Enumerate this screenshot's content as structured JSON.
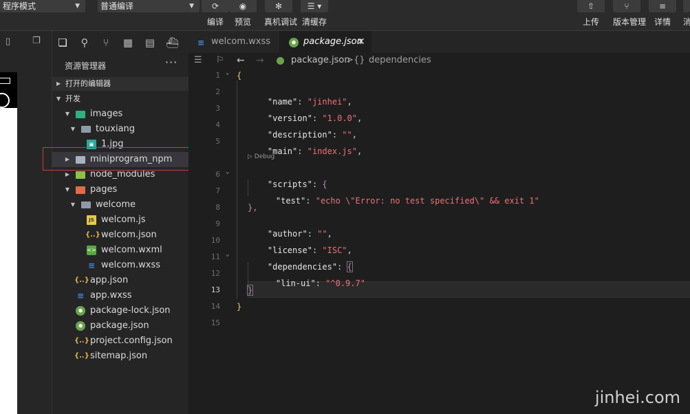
{
  "toolbar": {
    "mode_select": "程序模式",
    "compile_select": "普通编译",
    "compile_label": "编译",
    "preview_label": "预览",
    "debug_label": "真机调试",
    "clear_cache_label": "清缓存",
    "upload_label": "上传",
    "version_label": "版本管理",
    "detail_label": "详情",
    "msg_label": "消"
  },
  "explorer": {
    "title": "资源管理器",
    "more": "···",
    "section_open": "打开的编辑器",
    "section_dev": "开发",
    "tree": [
      {
        "name": "images"
      },
      {
        "name": "touxiang"
      },
      {
        "name": "1.jpg"
      },
      {
        "name": "miniprogram_npm"
      },
      {
        "name": "node_modules"
      },
      {
        "name": "pages"
      },
      {
        "name": "welcome"
      },
      {
        "name": "welcom.js"
      },
      {
        "name": "welcom.json"
      },
      {
        "name": "welcom.wxml"
      },
      {
        "name": "welcom.wxss"
      },
      {
        "name": "app.json"
      },
      {
        "name": "app.wxss"
      },
      {
        "name": "package-lock.json"
      },
      {
        "name": "package.json"
      },
      {
        "name": "project.config.json"
      },
      {
        "name": "sitemap.json"
      }
    ]
  },
  "tabs": [
    {
      "label": "welcom.wxss"
    },
    {
      "label": "package.json"
    }
  ],
  "breadcrumb": {
    "file": "package.json",
    "sep": ">",
    "braces": "{}",
    "node": "dependencies"
  },
  "editor": {
    "codelens": "▷ Debug",
    "line_numbers": [
      "1",
      "2",
      "3",
      "4",
      "5",
      "6",
      "7",
      "8",
      "9",
      "10",
      "11",
      "12",
      "13",
      "14",
      "15"
    ],
    "l1": "{",
    "l2_key": "\"name\"",
    "l2_val": "\"jinhei\"",
    "l3_key": "\"version\"",
    "l3_val": "\"1.0.0\"",
    "l4_key": "\"description\"",
    "l4_val": "\"\"",
    "l5_key": "\"main\"",
    "l5_val": "\"index.js\"",
    "l6_key": "\"scripts\"",
    "l6_open": "{",
    "l7_key": "\"test\"",
    "l7_val": "\"echo \\\"Error: no test specified\\\" && exit 1\"",
    "l8": "},",
    "l9_key": "\"author\"",
    "l9_val": "\"\"",
    "l10_key": "\"license\"",
    "l10_val": "\"ISC\"",
    "l11_key": "\"dependencies\"",
    "l11_open": "{",
    "l12_key": "\"lin-ui\"",
    "l12_val": "\"^0.9.7\"",
    "l13": "}",
    "l14": "}"
  },
  "watermark": "jinhei.com",
  "colors": {
    "accent_string": "#f07178",
    "annotation_red": "#d23b3b"
  }
}
